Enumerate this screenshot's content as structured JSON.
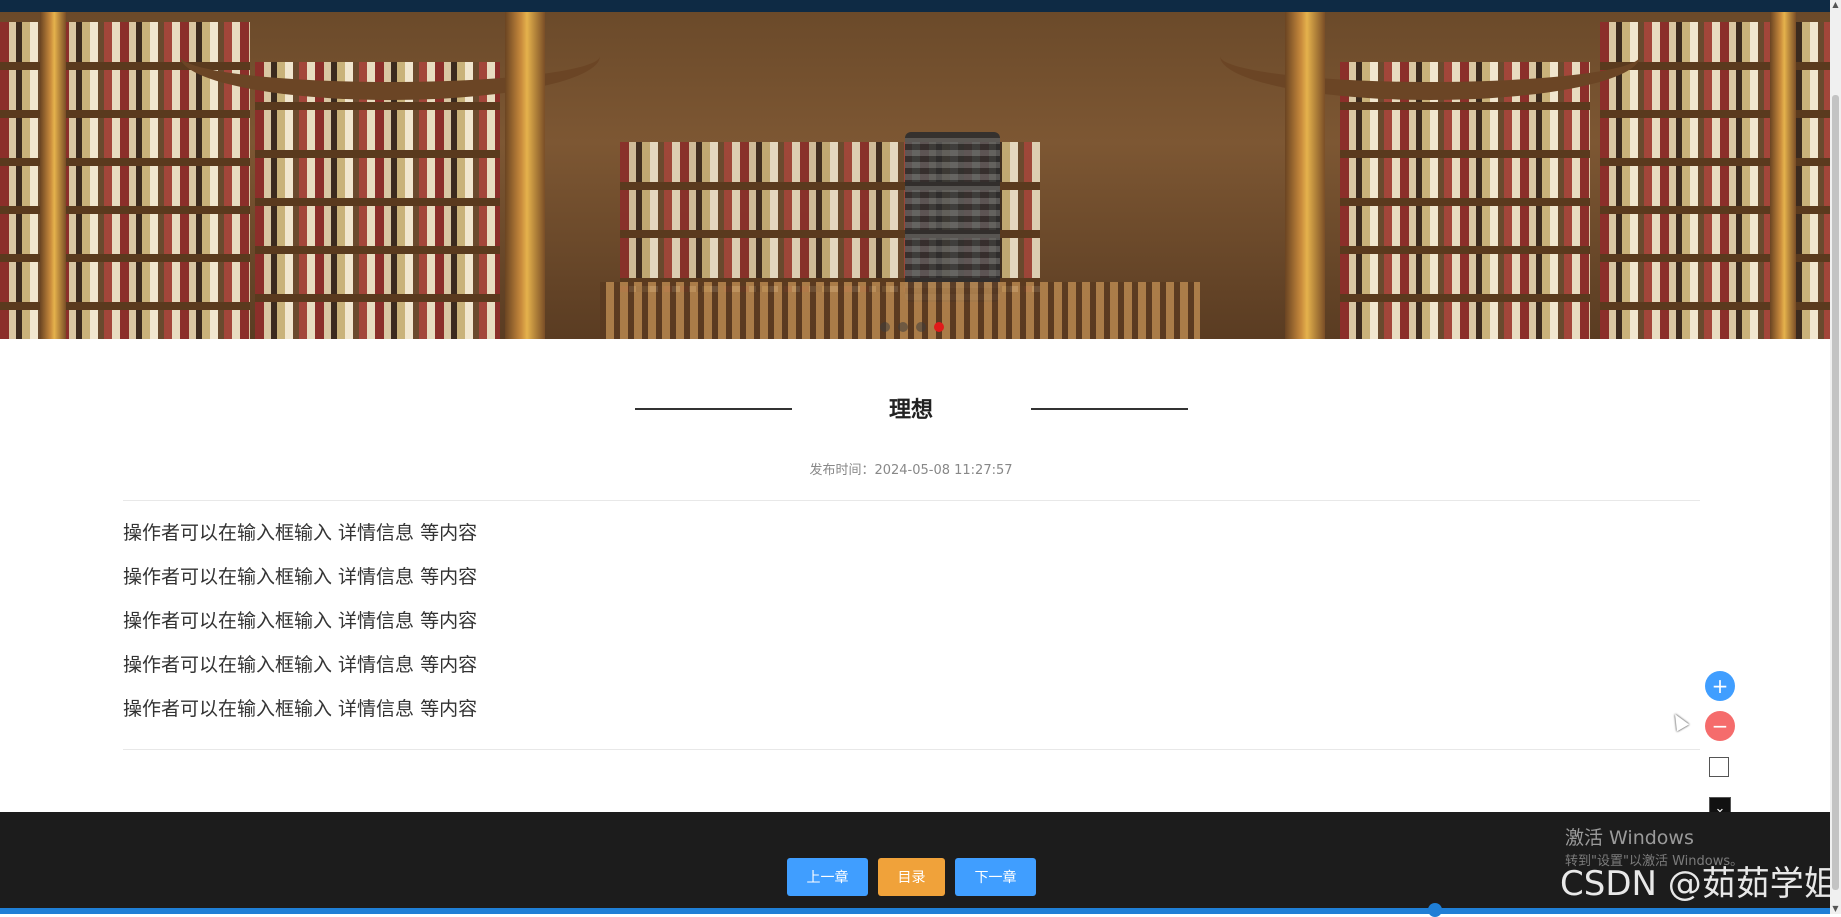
{
  "banner": {
    "alt": "library bookshelves",
    "carousel_dots": 4,
    "active_dot": 3
  },
  "article": {
    "title": "理想",
    "publish_time": "发布时间：2024-05-08 11:27:57",
    "paragraphs": [
      "操作者可以在输入框输入  详情信息  等内容",
      "操作者可以在输入框输入  详情信息  等内容",
      "操作者可以在输入框输入  详情信息  等内容",
      "操作者可以在输入框输入  详情信息  等内容",
      "操作者可以在输入框输入  详情信息  等内容"
    ]
  },
  "controls": {
    "zoom_in": "+",
    "zoom_out": "−",
    "download": "⌄"
  },
  "footer": {
    "prev_label": "上一章",
    "toc_label": "目录",
    "next_label": "下一章"
  },
  "watermark": {
    "activate_title": "激活 Windows",
    "activate_sub": "转到\"设置\"以激活 Windows。",
    "csdn": "CSDN @茹茹学姐"
  },
  "colors": {
    "primary": "#409eff",
    "warning": "#f0a23a",
    "danger": "#f56c6c",
    "footer_bg": "#1c1c1c"
  }
}
